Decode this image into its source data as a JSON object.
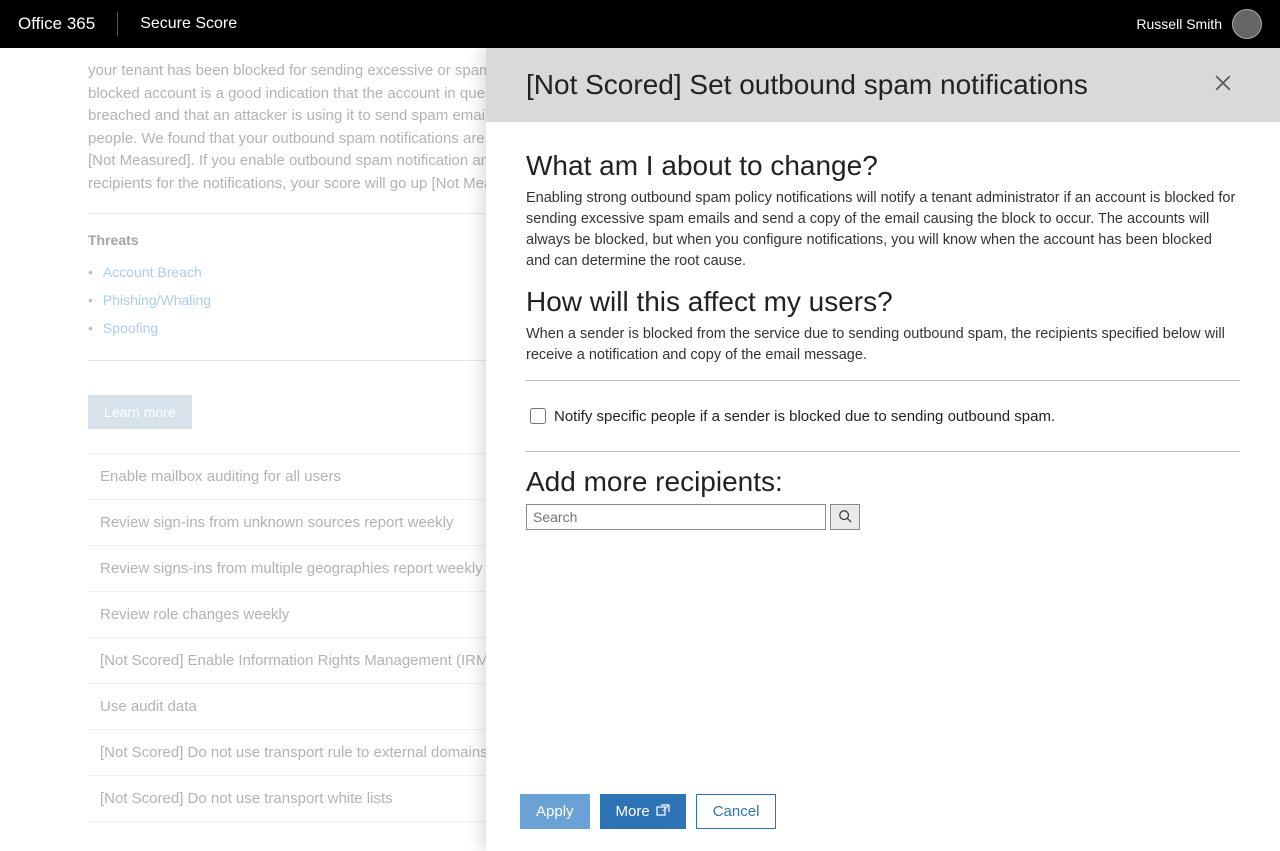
{
  "topbar": {
    "brand": "Office 365",
    "app": "Secure Score",
    "user": "Russell Smith"
  },
  "background": {
    "description": "your tenant has been blocked for sending excessive or spam emails. A blocked account is a good indication that the account in question has been breached and that an attacker is using it to send spam emails to other people. We found that your outbound spam notifications are configured to [Not Measured]. If you enable outbound spam notification and designate recipients for the notifications, your score will go up [Not Measured] points.",
    "threats_title": "Threats",
    "threats": [
      "Account Breach",
      "Phishing/Whaling",
      "Spoofing"
    ],
    "learn_more": "Learn more",
    "actions": [
      "Enable mailbox auditing for all users",
      "Review sign-ins from unknown sources report weekly",
      "Review signs-ins from multiple geographies report weekly",
      "Review role changes weekly",
      "[Not Scored] Enable Information Rights Management (IRM) services",
      "Use audit data",
      "[Not Scored] Do not use transport rule to external domains",
      "[Not Scored] Do not use transport white lists"
    ]
  },
  "panel": {
    "title": "[Not Scored] Set outbound spam notifications",
    "h1": "What am I about to change?",
    "p1": "Enabling strong outbound spam policy notifications will notify a tenant administrator if an account is blocked for sending excessive spam emails and send a copy of the email causing the block to occur. The accounts will always be blocked, but when you configure notifications, you will know when the account has been blocked and can determine the root cause.",
    "h2": "How will this affect my users?",
    "p2": "When a sender is blocked from the service due to sending outbound spam, the recipients specified below will receive a notification and copy of the email message.",
    "checkbox_label": "Notify specific people if a sender is blocked due to sending outbound spam.",
    "add_recipients": "Add more recipients:",
    "search_placeholder": "Search",
    "apply": "Apply",
    "more": "More",
    "cancel": "Cancel"
  }
}
